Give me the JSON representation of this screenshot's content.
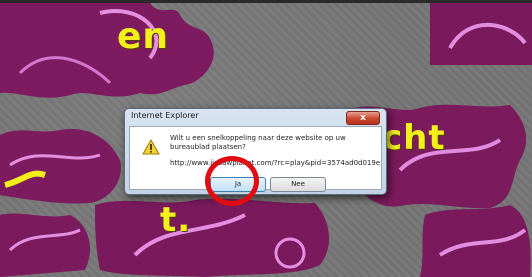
{
  "background": {
    "words": [
      "en",
      "cht",
      "t."
    ]
  },
  "dialog": {
    "title": "Internet Explorer",
    "close_label": "x",
    "message": "Wilt u een snelkoppeling naar deze website op uw bureaublad plaatsen?",
    "url": "http://www.jigsawplanet.com/?rc=play&pid=3574ad0d019e",
    "yes_label": "Ja",
    "no_label": "Nee",
    "icon": "warning-icon"
  },
  "colors": {
    "puzzle_purple": "#7d1b5e",
    "text_yellow": "#f2ef1b",
    "highlight_ring": "#e00c12",
    "dialog_blue": "#c3d2e3"
  }
}
